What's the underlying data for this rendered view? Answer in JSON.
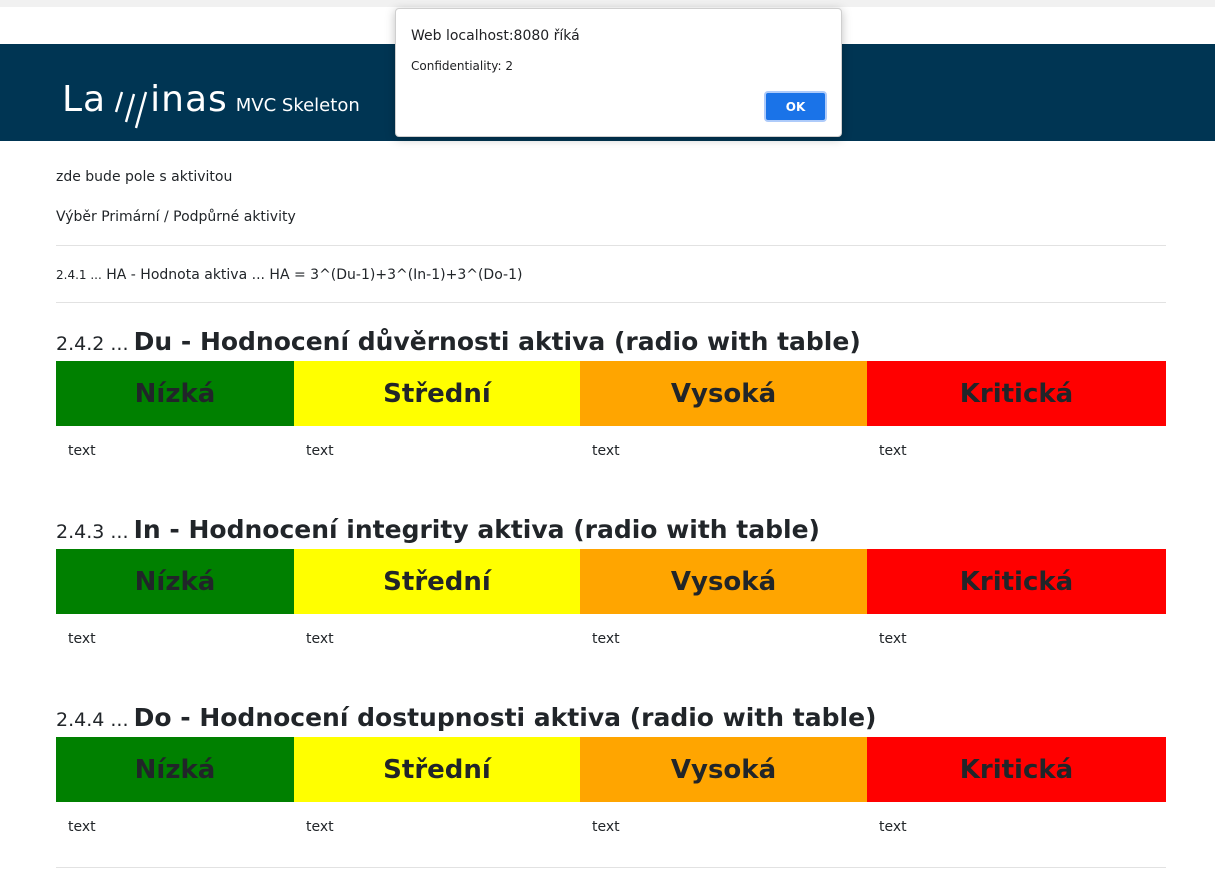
{
  "header": {
    "logo_left": "La",
    "logo_right": "inas",
    "logo_sub": "MVC Skeleton"
  },
  "content": {
    "line1": "zde bude pole s aktivitou",
    "line2": "Výběr Primární / Podpůrné aktivity",
    "formula_num": "2.4.1 ...",
    "formula_text": "HA - Hodnota aktiva ... HA = 3^(Du-1)+3^(In-1)+3^(Do-1)"
  },
  "levels": [
    {
      "label": "Nízká",
      "color": "#008000",
      "text": "text"
    },
    {
      "label": "Střední",
      "color": "#ffff00",
      "text": "text"
    },
    {
      "label": "Vysoká",
      "color": "#ffa500",
      "text": "text"
    },
    {
      "label": "Kritická",
      "color": "#ff0000",
      "text": "text"
    }
  ],
  "sections": [
    {
      "num": "2.4.2 ...",
      "title": "Du - Hodnocení důvěrnosti aktiva (radio with table)"
    },
    {
      "num": "2.4.3 ...",
      "title": "In - Hodnocení integrity aktiva (radio with table)"
    },
    {
      "num": "2.4.4 ...",
      "title": "Do - Hodnocení dostupnosti aktiva (radio with table)"
    }
  ],
  "dialog": {
    "title": "Web localhost:8080 říká",
    "message": "Confidentiality: 2",
    "ok": "OK"
  }
}
